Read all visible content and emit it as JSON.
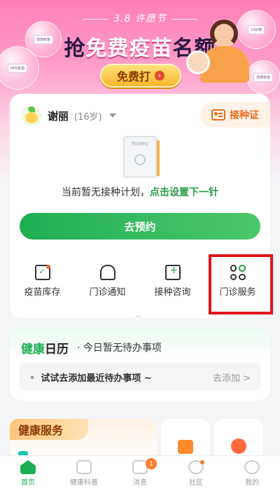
{
  "banner": {
    "festival": "3.8 许愿节",
    "headline_a": "抢",
    "headline_b": "免费疫苗",
    "headline_c": "名额",
    "button": "免费打",
    "vial_labels": [
      "流感疫苗",
      "13价肺",
      "HPV疫苗",
      "流感疫苗"
    ]
  },
  "user": {
    "name": "谢丽",
    "age": "(16岁)",
    "cert_label": "接种证"
  },
  "book": {
    "label": "预防接种证"
  },
  "plan": {
    "text": "当前暂无接种计划，",
    "link": "点击设置下一针"
  },
  "book_button": "去预约",
  "grid": [
    {
      "label": "疫苗库存",
      "icon": "vaccine-stock-icon",
      "dot": true
    },
    {
      "label": "门诊通知",
      "icon": "bell-icon",
      "dot": false
    },
    {
      "label": "接种咨询",
      "icon": "consult-icon",
      "dot": false
    },
    {
      "label": "门诊服务",
      "icon": "clinic-service-icon",
      "dot": false
    }
  ],
  "calendar": {
    "title_a": "健康",
    "title_b": "日历",
    "sub": "· 今日暂无待办事项",
    "row_label": "试试去添加最近待办事项 ~",
    "row_action": "去添加 >"
  },
  "service": {
    "title": "健康服务"
  },
  "tabs": [
    {
      "label": "首页",
      "active": true
    },
    {
      "label": "健康科普",
      "active": false
    },
    {
      "label": "消息",
      "active": false,
      "badge": "1"
    },
    {
      "label": "社区",
      "active": false,
      "dot": true
    },
    {
      "label": "我的",
      "active": false
    }
  ],
  "colors": {
    "primary": "#1fae52",
    "accent": "#e86b1e",
    "highlight": "#e0151b"
  }
}
